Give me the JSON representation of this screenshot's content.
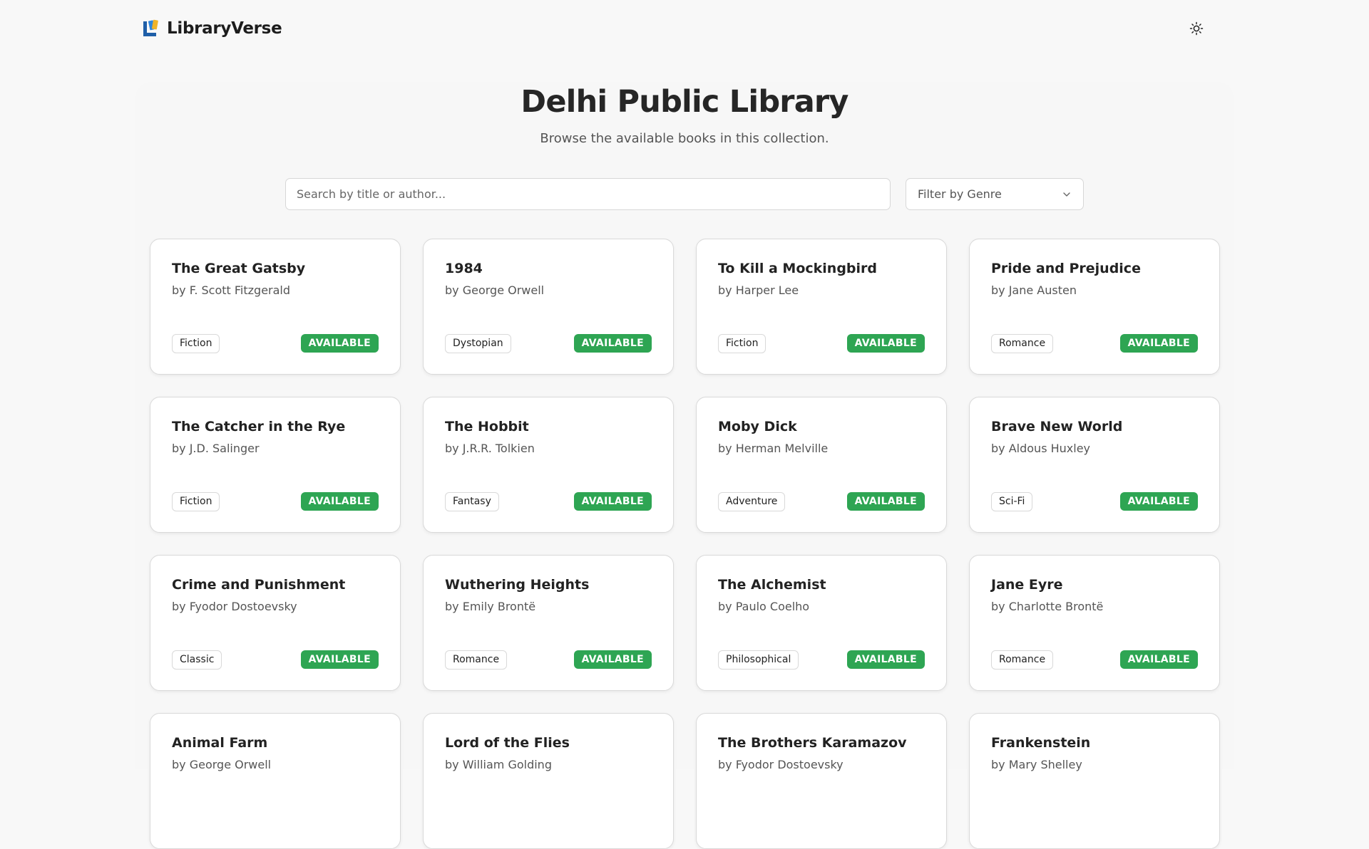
{
  "brand": {
    "name": "LibraryVerse"
  },
  "header": {
    "title": "Delhi Public Library",
    "subtitle": "Browse the available books in this collection."
  },
  "search": {
    "placeholder": "Search by title or author..."
  },
  "filter": {
    "label": "Filter by Genre"
  },
  "icons": {
    "theme": "sun-icon",
    "dropdown": "chevron-down-icon",
    "logo": "library-logo-icon"
  },
  "colors": {
    "available": "#2ea553",
    "logo_blue": "#1f5fa8"
  },
  "books": [
    {
      "title": "The Great Gatsby",
      "author": "by F. Scott Fitzgerald",
      "genre": "Fiction",
      "status": "AVAILABLE"
    },
    {
      "title": "1984",
      "author": "by George Orwell",
      "genre": "Dystopian",
      "status": "AVAILABLE"
    },
    {
      "title": "To Kill a Mockingbird",
      "author": "by Harper Lee",
      "genre": "Fiction",
      "status": "AVAILABLE"
    },
    {
      "title": "Pride and Prejudice",
      "author": "by Jane Austen",
      "genre": "Romance",
      "status": "AVAILABLE"
    },
    {
      "title": "The Catcher in the Rye",
      "author": "by J.D. Salinger",
      "genre": "Fiction",
      "status": "AVAILABLE"
    },
    {
      "title": "The Hobbit",
      "author": "by J.R.R. Tolkien",
      "genre": "Fantasy",
      "status": "AVAILABLE"
    },
    {
      "title": "Moby Dick",
      "author": "by Herman Melville",
      "genre": "Adventure",
      "status": "AVAILABLE"
    },
    {
      "title": "Brave New World",
      "author": "by Aldous Huxley",
      "genre": "Sci-Fi",
      "status": "AVAILABLE"
    },
    {
      "title": "Crime and Punishment",
      "author": "by Fyodor Dostoevsky",
      "genre": "Classic",
      "status": "AVAILABLE"
    },
    {
      "title": "Wuthering Heights",
      "author": "by Emily Brontë",
      "genre": "Romance",
      "status": "AVAILABLE"
    },
    {
      "title": "The Alchemist",
      "author": "by Paulo Coelho",
      "genre": "Philosophical",
      "status": "AVAILABLE"
    },
    {
      "title": "Jane Eyre",
      "author": "by Charlotte Brontë",
      "genre": "Romance",
      "status": "AVAILABLE"
    },
    {
      "title": "Animal Farm",
      "author": "by George Orwell"
    },
    {
      "title": "Lord of the Flies",
      "author": "by William Golding"
    },
    {
      "title": "The Brothers Karamazov",
      "author": "by Fyodor Dostoevsky"
    },
    {
      "title": "Frankenstein",
      "author": "by Mary Shelley"
    }
  ]
}
